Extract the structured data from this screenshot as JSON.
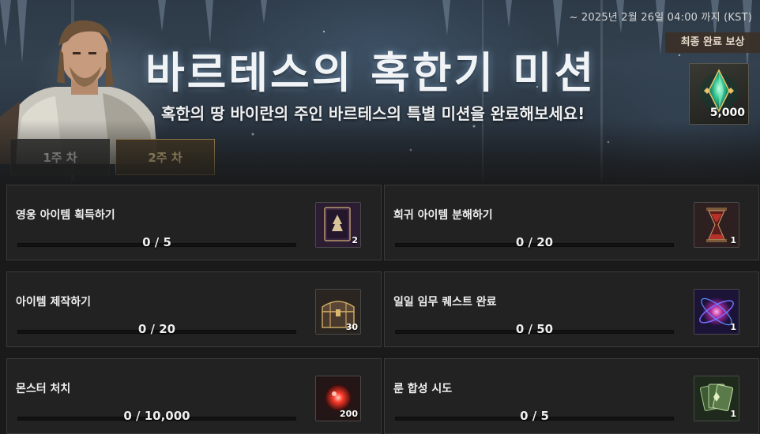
{
  "event": {
    "period": "~ 2025년 2월 26일 04:00 까지 (KST)",
    "title": "바르테스의 혹한기 미션",
    "subtitle": "혹한의 땅 바이란의 주인 바르테스의 특별 미션을 완료해보세요!"
  },
  "final_reward": {
    "label": "최종 완료 보상",
    "count": "5,000",
    "icon": "green-crystal-icon"
  },
  "tabs": [
    {
      "label": "1주 차",
      "selected": false
    },
    {
      "label": "2주 차",
      "selected": true
    }
  ],
  "missions": [
    {
      "name": "영웅 아이템 획득하기",
      "progress": "0 / 5",
      "ratio": 0,
      "reward_qty": "2",
      "reward_icon": "hero-item-book-icon"
    },
    {
      "name": "희귀 아이템 분해하기",
      "progress": "0 / 20",
      "ratio": 0,
      "reward_qty": "1",
      "reward_icon": "hourglass-icon"
    },
    {
      "name": "아이템 제작하기",
      "progress": "0 / 20",
      "ratio": 0,
      "reward_qty": "30",
      "reward_icon": "treasure-chest-icon"
    },
    {
      "name": "일일 임무 퀘스트 완료",
      "progress": "0 / 50",
      "ratio": 0,
      "reward_qty": "1",
      "reward_icon": "purple-orb-icon"
    },
    {
      "name": "몬스터 처치",
      "progress": "0 / 10,000",
      "ratio": 0,
      "reward_qty": "200",
      "reward_icon": "red-gem-icon"
    },
    {
      "name": "룬 합성 시도",
      "progress": "0 / 5",
      "ratio": 0,
      "reward_qty": "1",
      "reward_icon": "rune-cards-icon"
    }
  ],
  "colors": {
    "accent_gold": "#c9a862",
    "tab_selected_text": "#f0d690",
    "panel_bg": "#222222"
  }
}
